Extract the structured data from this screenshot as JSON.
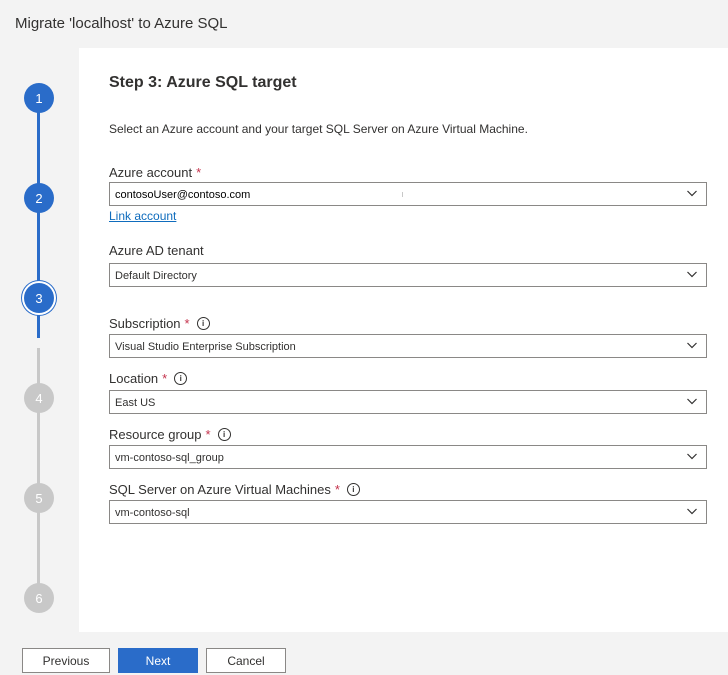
{
  "window": {
    "title": "Migrate 'localhost' to Azure SQL"
  },
  "stepper": {
    "steps": [
      {
        "number": "1",
        "state": "done"
      },
      {
        "number": "2",
        "state": "done"
      },
      {
        "number": "3",
        "state": "current"
      },
      {
        "number": "4",
        "state": "todo"
      },
      {
        "number": "5",
        "state": "todo"
      },
      {
        "number": "6",
        "state": "todo"
      }
    ]
  },
  "page": {
    "heading": "Step 3: Azure SQL target",
    "description": "Select an Azure account and your target SQL Server on Azure Virtual Machine."
  },
  "fields": {
    "azure_account": {
      "label": "Azure account",
      "required": "*",
      "value": "contosoUser@contoso.com",
      "link": "Link account"
    },
    "tenant": {
      "label": "Azure AD tenant",
      "value": "Default Directory"
    },
    "subscription": {
      "label": "Subscription",
      "required": "*",
      "value": "Visual Studio Enterprise Subscription"
    },
    "location": {
      "label": "Location",
      "required": "*",
      "value": "East US"
    },
    "resource_group": {
      "label": "Resource group",
      "required": "*",
      "value": "vm-contoso-sql_group"
    },
    "sql_server": {
      "label": "SQL Server on Azure Virtual Machines",
      "required": "*",
      "value": "vm-contoso-sql"
    }
  },
  "footer": {
    "previous": "Previous",
    "next": "Next",
    "cancel": "Cancel"
  },
  "colors": {
    "accent": "#2a6cc9",
    "pending": "#c8c8c8",
    "required": "#c4314b",
    "link": "#0f6cbd"
  },
  "icons": {
    "dropdown": "chevron-down-icon",
    "info": "info-icon"
  }
}
